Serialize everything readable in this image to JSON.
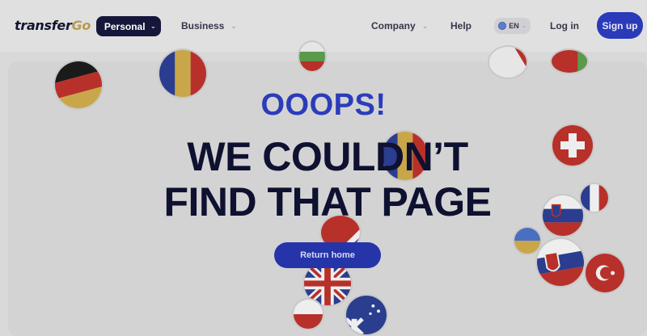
{
  "header": {
    "logo_part1": "transfer",
    "logo_part2": "Go",
    "nav": {
      "personal": "Personal",
      "business": "Business",
      "company": "Company",
      "help": "Help"
    },
    "language": "EN",
    "login": "Log in",
    "signup": "Sign up"
  },
  "main": {
    "eyebrow": "OOOPS!",
    "headline_line1": "WE COULDN’T",
    "headline_line2": "FIND THAT PAGE",
    "cta": "Return home"
  },
  "colors": {
    "accent": "#2b3cba",
    "dark_navy": "#15173a",
    "background": "#d9d9d9"
  },
  "icons": [
    "chevron-down-icon",
    "globe-icon",
    "flag-icon"
  ]
}
